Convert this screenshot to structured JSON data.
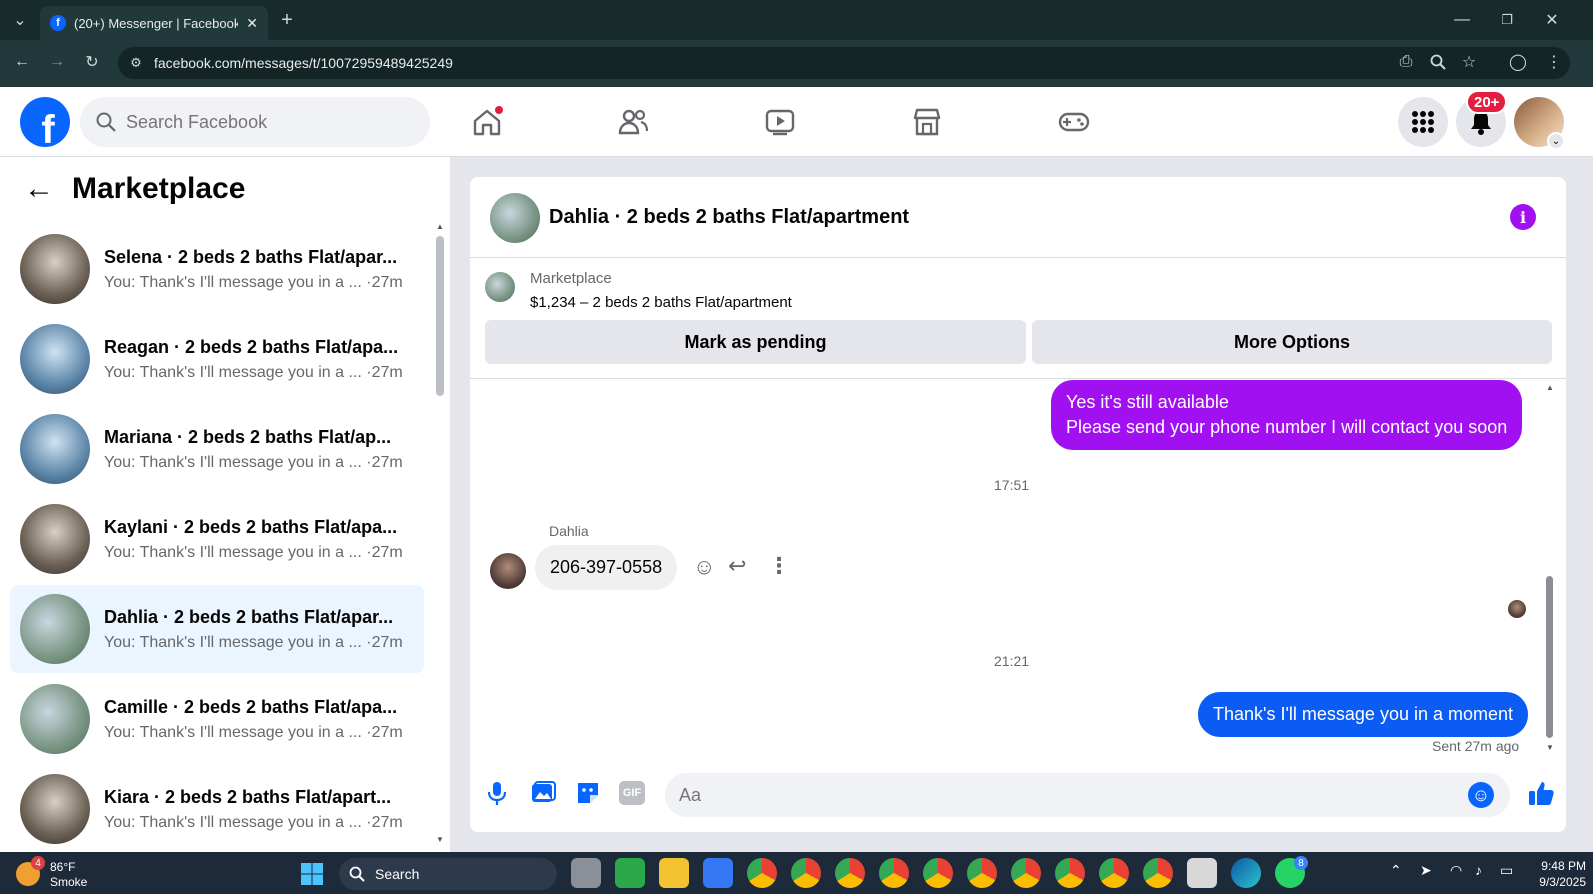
{
  "browser": {
    "tab_title": "(20+) Messenger | Facebook",
    "url": "facebook.com/messages/t/10072959489425249"
  },
  "header": {
    "search_placeholder": "Search Facebook",
    "notification_badge": "20+"
  },
  "left_panel": {
    "title": "Marketplace",
    "conversations": [
      {
        "name": "Selena · 2 beds 2 baths Flat/apar...",
        "snippet": "You: Thank's I'll message you in a ... ·27m",
        "active": false
      },
      {
        "name": "Reagan · 2 beds 2 baths Flat/apa...",
        "snippet": "You: Thank's I'll message you in a ... ·27m",
        "active": false
      },
      {
        "name": "Mariana · 2 beds 2 baths Flat/ap...",
        "snippet": "You: Thank's I'll message you in a ... ·27m",
        "active": false
      },
      {
        "name": "Kaylani · 2 beds 2 baths Flat/apa...",
        "snippet": "You: Thank's I'll message you in a ... ·27m",
        "active": false
      },
      {
        "name": "Dahlia · 2 beds 2 baths Flat/apar...",
        "snippet": "You: Thank's I'll message you in a ... ·27m",
        "active": true
      },
      {
        "name": "Camille · 2 beds 2 baths Flat/apa...",
        "snippet": "You: Thank's I'll message you in a ... ·27m",
        "active": false
      },
      {
        "name": "Kiara · 2 beds 2 baths Flat/apart...",
        "snippet": "You: Thank's I'll message you in a ... ·27m",
        "active": false
      }
    ]
  },
  "chat": {
    "title": "Dahlia · 2 beds 2 baths Flat/apartment",
    "listing": {
      "label": "Marketplace",
      "price_line": "$1,234 – 2 beds 2 baths Flat/apartment",
      "mark_pending_label": "Mark as pending",
      "more_options_label": "More Options"
    },
    "messages": {
      "outgoing_1_line1": "Yes it's still available",
      "outgoing_1_line2": "Please send your phone number I will contact you soon",
      "time_1": "17:51",
      "sender_name": "Dahlia",
      "incoming_1": "206-397-0558",
      "time_2": "21:21",
      "outgoing_2": "Thank's I'll message you in a moment",
      "sent_status": "Sent 27m ago"
    },
    "composer_placeholder": "Aa",
    "colors": {
      "outgoing_purple": "#a010f0",
      "outgoing_blue": "#0a5cf5",
      "accent": "#0866ff"
    }
  },
  "taskbar": {
    "weather_temp": "86°F",
    "weather_desc": "Smoke",
    "weather_badge": "4",
    "search_label": "Search",
    "whatsapp_badge": "8",
    "time": "9:48 PM",
    "date": "9/3/2025"
  }
}
